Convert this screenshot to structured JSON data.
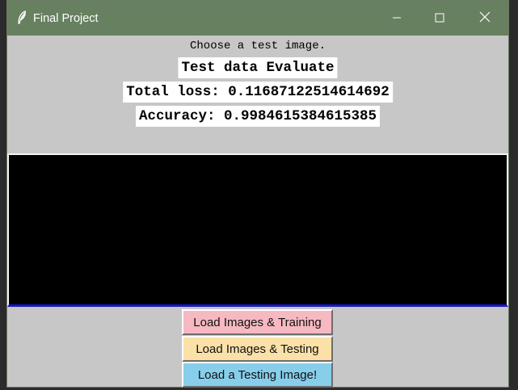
{
  "window": {
    "title": "Final Project",
    "title_icon": "feather-icon",
    "controls": [
      "minimize-icon",
      "maximize-icon",
      "close-icon"
    ],
    "titlebar_color": "#67805f",
    "background_color": "#c7c7c7"
  },
  "status": {
    "prompt": "Choose a test image.",
    "heading": "Test data Evaluate",
    "loss": "Total loss: 0.11687122514614692",
    "accuracy": "Accuracy: 0.9984615384615385"
  },
  "image_panel": {
    "background": "#000000"
  },
  "buttons": {
    "train": {
      "label": "Load Images & Training",
      "color": "#f6b8c1"
    },
    "test": {
      "label": "Load Images & Testing",
      "color": "#fbe0a8"
    },
    "single": {
      "label": "Load a Testing Image!",
      "color": "#87ceeb"
    }
  }
}
